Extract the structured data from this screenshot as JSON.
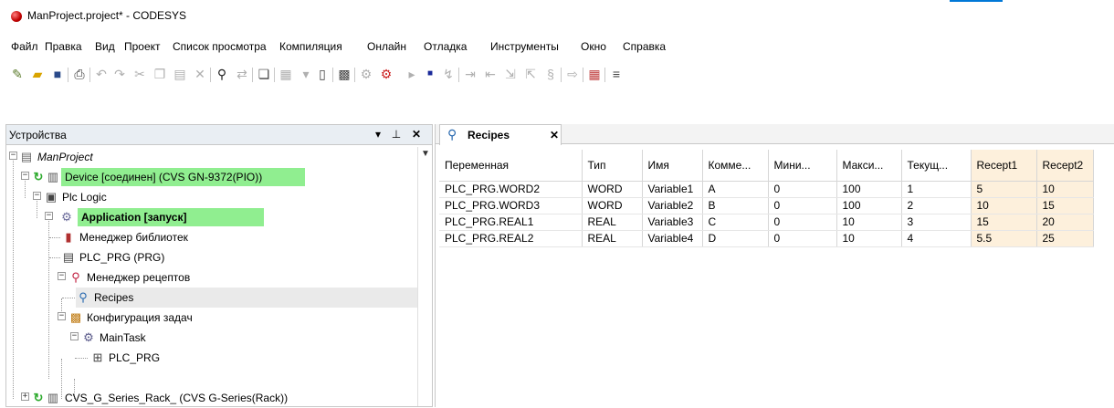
{
  "window": {
    "title": "ManProject.project* - CODESYS"
  },
  "menu": [
    "Файл",
    "Правка",
    "Вид",
    "Проект",
    "Список просмотра",
    "Компиляция",
    "Онлайн",
    "Отладка",
    "Инструменты",
    "Окно",
    "Справка"
  ],
  "devices_pane": {
    "title": "Устройства",
    "tree": [
      {
        "label": "ManProject",
        "icon": "project-icon"
      },
      {
        "label": "Device [соединен] (CVS GN-9372(PIO))",
        "icon": "device-icon",
        "status": "connected"
      },
      {
        "label": "Plc Logic",
        "icon": "plc-logic-icon"
      },
      {
        "label": "Application [запуск]",
        "icon": "application-gear-icon",
        "status": "running"
      },
      {
        "label": "Менеджер библиотек",
        "icon": "library-manager-icon"
      },
      {
        "label": "PLC_PRG (PRG)",
        "icon": "pou-icon"
      },
      {
        "label": "Менеджер рецептов",
        "icon": "recipe-manager-icon"
      },
      {
        "label": "Recipes",
        "icon": "recipe-icon",
        "selected": true
      },
      {
        "label": "Конфигурация задач",
        "icon": "task-config-icon"
      },
      {
        "label": "MainTask",
        "icon": "task-icon"
      },
      {
        "label": "PLC_PRG",
        "icon": "program-call-icon"
      },
      {
        "label": "CVS_G_Series_Rack_ (CVS G-Series(Rack))",
        "icon": "rack-icon"
      }
    ]
  },
  "editor": {
    "tab_label": "Recipes",
    "columns": [
      "Переменная",
      "Тип",
      "Имя",
      "Комме...",
      "Мини...",
      "Макси...",
      "Текущ...",
      "Recept1",
      "Recept2"
    ],
    "rows": [
      [
        "PLC_PRG.WORD2",
        "WORD",
        "Variable1",
        "A",
        "0",
        "100",
        "1",
        "5",
        "10"
      ],
      [
        "PLC_PRG.WORD3",
        "WORD",
        "Variable2",
        "B",
        "0",
        "100",
        "2",
        "10",
        "15"
      ],
      [
        "PLC_PRG.REAL1",
        "REAL",
        "Variable3",
        "C",
        "0",
        "10",
        "3",
        "15",
        "20"
      ],
      [
        "PLC_PRG.REAL2",
        "REAL",
        "Variable4",
        "D",
        "0",
        "10",
        "4",
        "5.5",
        "25"
      ]
    ]
  },
  "colors": {
    "status_highlight": "#90ee90",
    "recipe_column": "#fdf0dc",
    "pane_header": "#e9eef3"
  }
}
